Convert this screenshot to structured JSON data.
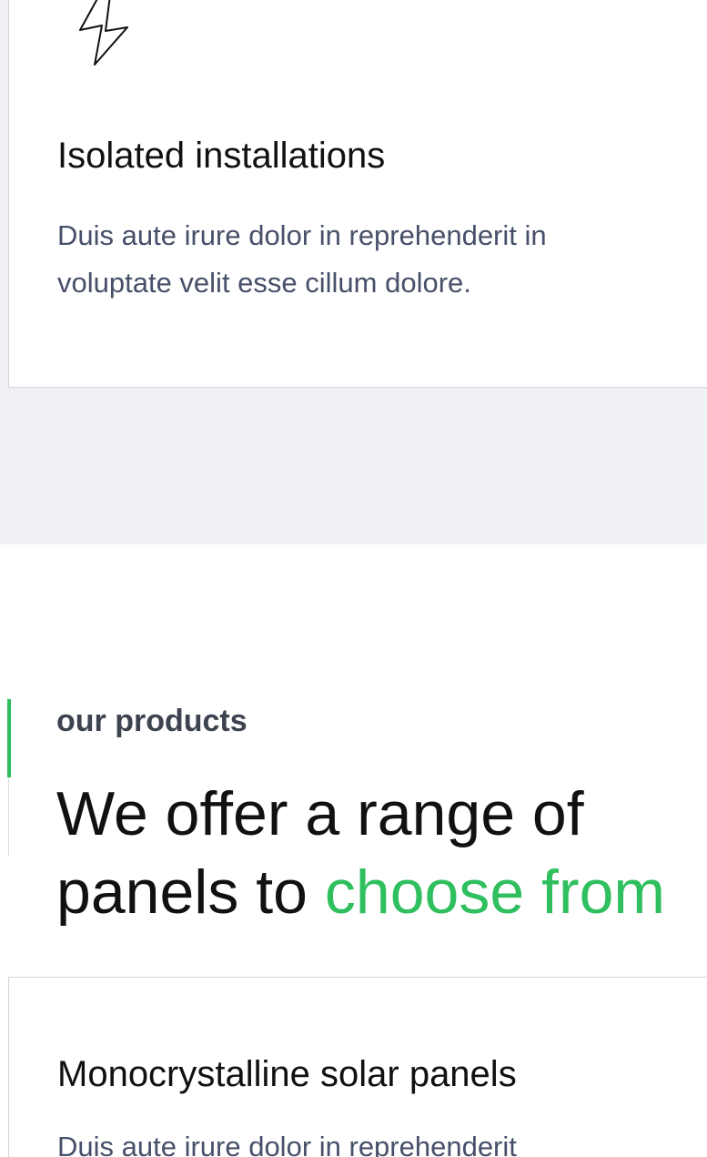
{
  "features": {
    "card": {
      "icon": "lightning-bolt-icon",
      "title": "Isolated installations",
      "text_line1": "Duis aute irure dolor in reprehenderit in",
      "text_line2": "voluptate velit esse cillum dolore."
    }
  },
  "products": {
    "eyebrow": "our products",
    "heading_line1": "We offer a range of",
    "heading_line2_plain": "panels to ",
    "heading_line2_accent": "choose from",
    "card": {
      "title": "Monocrystalline solar panels",
      "text_line1": "Duis aute irure dolor in reprehenderit"
    }
  },
  "colors": {
    "accent": "#2fbf5e",
    "body_text": "#475069",
    "band_background": "#f0f1f5",
    "card_border": "#d3d4dd"
  }
}
